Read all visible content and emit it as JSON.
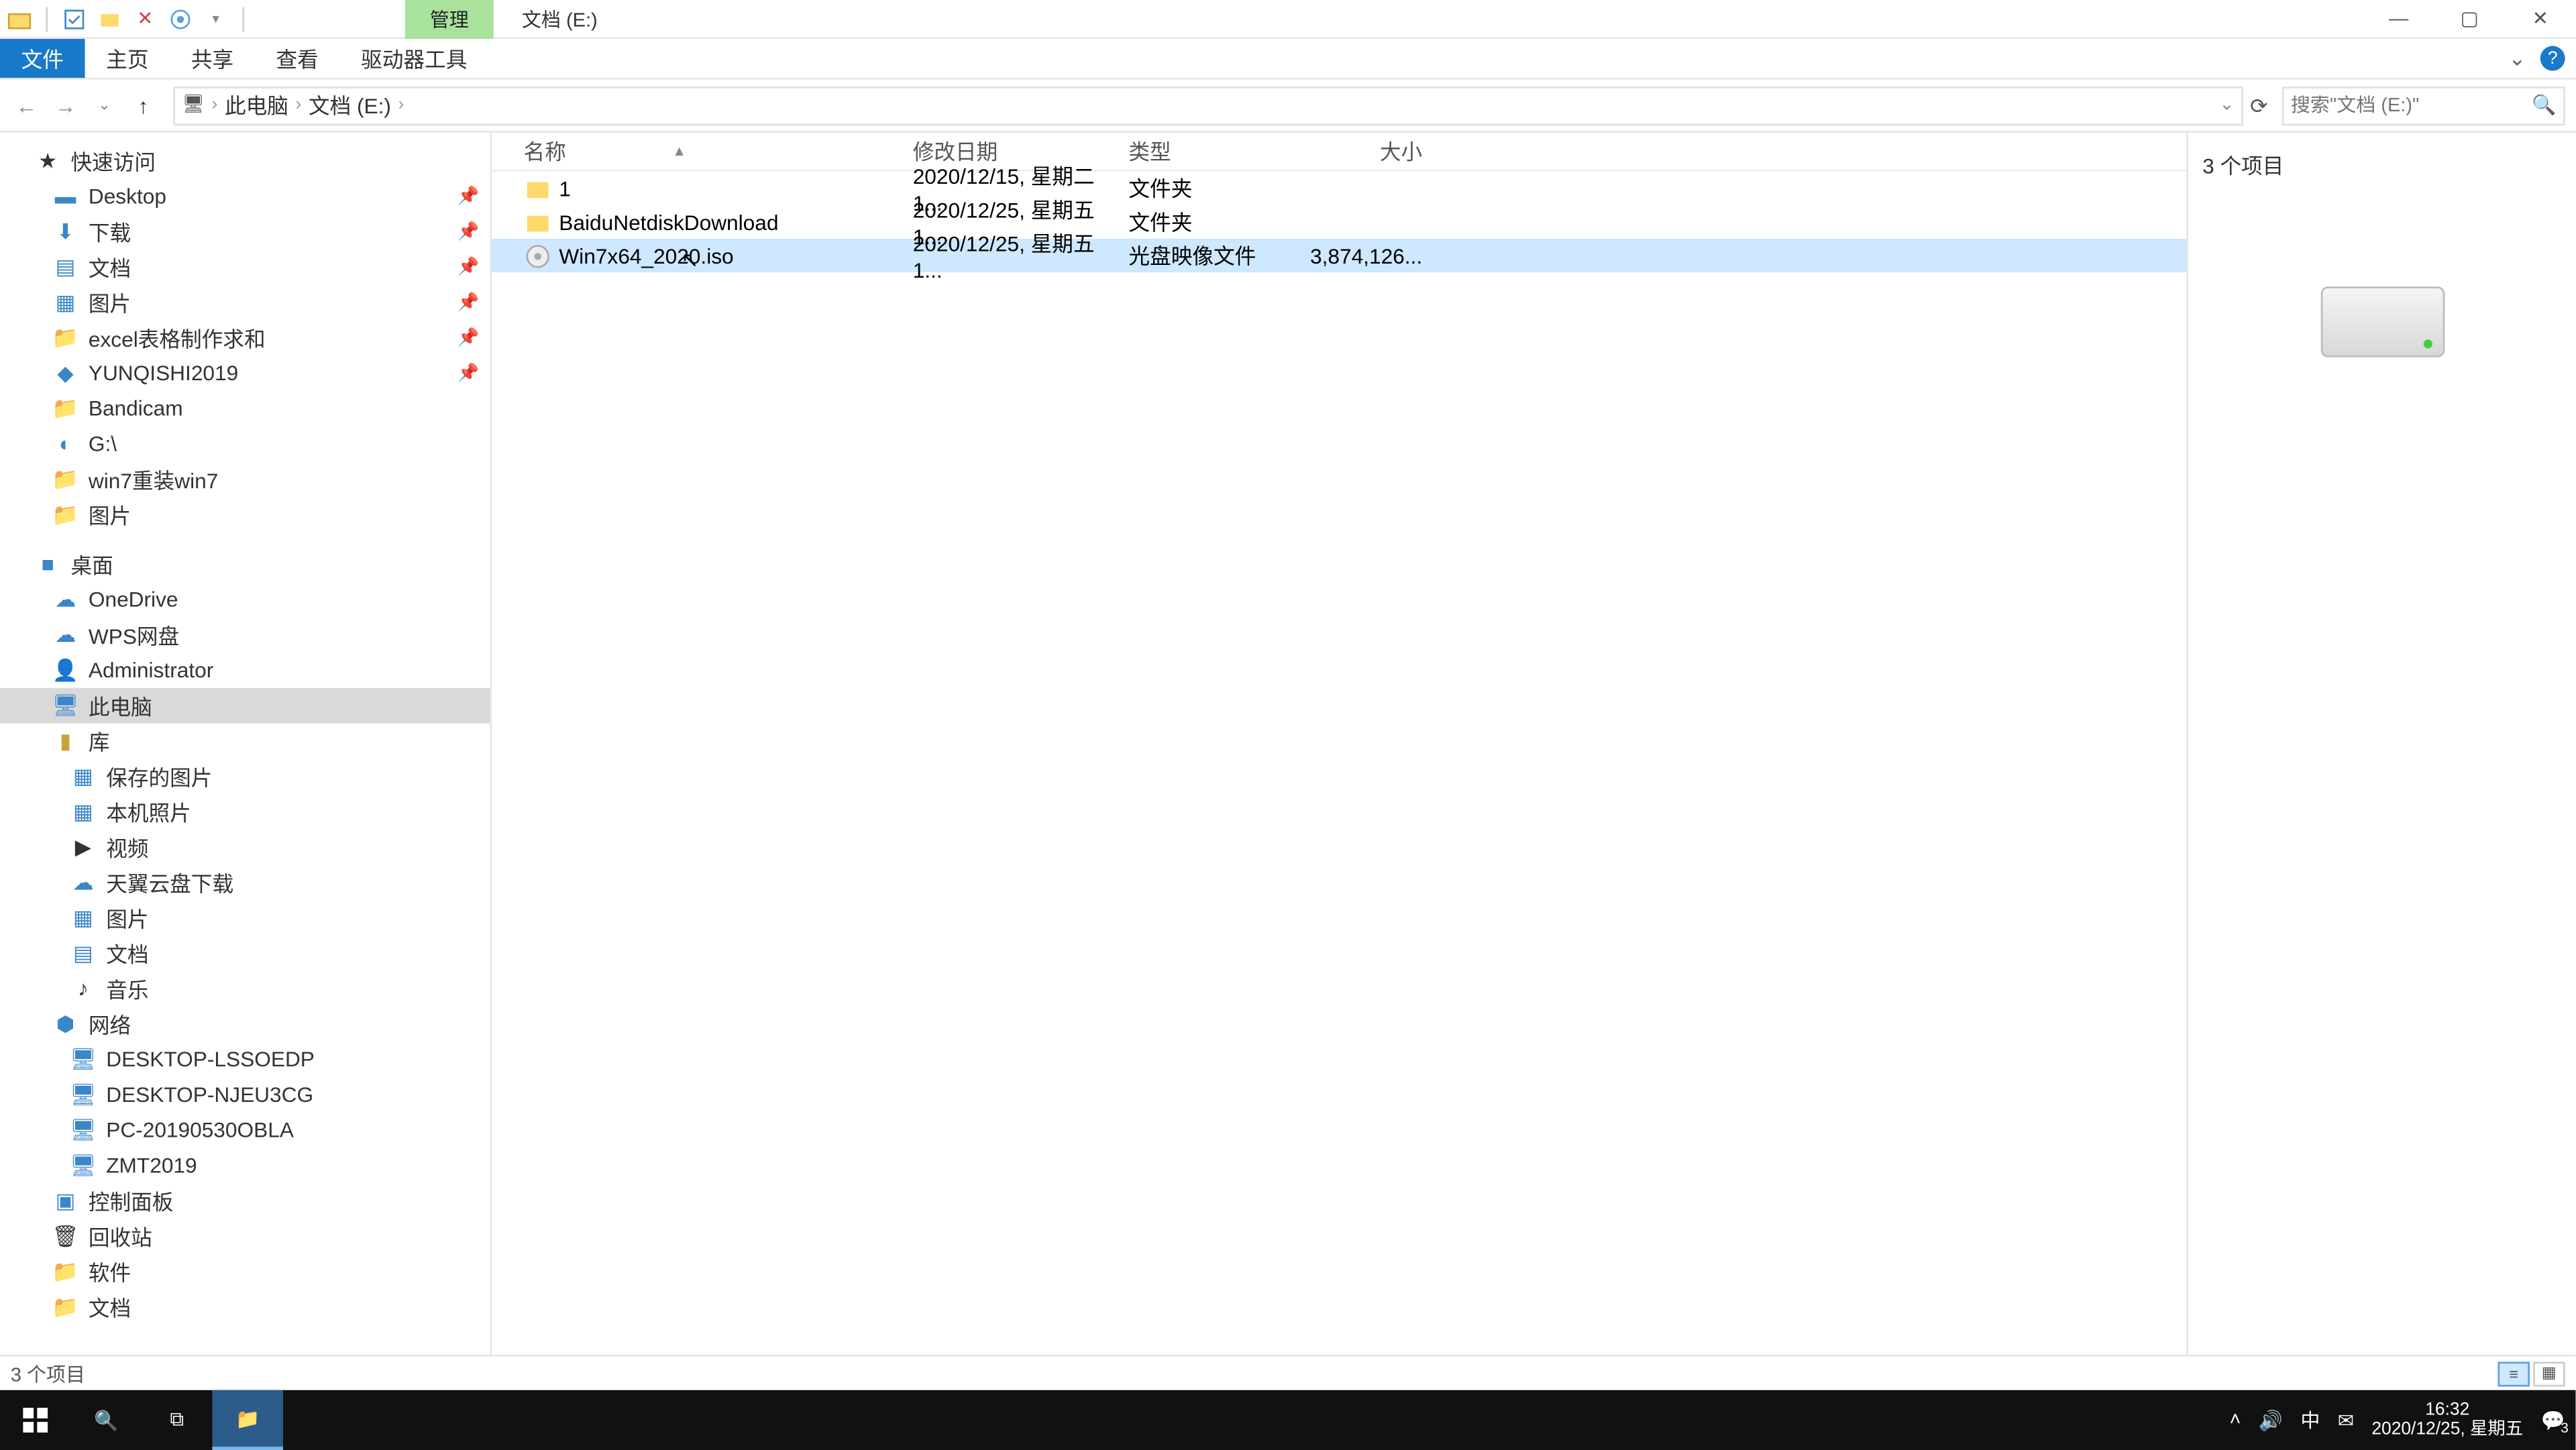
{
  "title": {
    "tools_tab": "管理",
    "location": "文档 (E:)"
  },
  "winbtns": {
    "min": "—",
    "max": "▢",
    "close": "✕"
  },
  "ribbon": {
    "file": "文件",
    "home": "主页",
    "share": "共享",
    "view": "查看",
    "drive_tools": "驱动器工具",
    "expand": "⌄",
    "help": "?"
  },
  "nav": {
    "back": "←",
    "fwd": "→",
    "recent": "⌄",
    "up": "↑"
  },
  "crumb": {
    "root_icon": "🖥",
    "pc": "此电脑",
    "drive": "文档 (E:)",
    "dropdown": "⌄",
    "refresh": "⟳"
  },
  "search": {
    "placeholder": "搜索\"文档 (E:)\"",
    "icon": "🔍"
  },
  "tree": {
    "quick": "快速访问",
    "desktop": "Desktop",
    "downloads": "下载",
    "docs": "文档",
    "pics": "图片",
    "excel": "excel表格制作求和",
    "yunqishi": "YUNQISHI2019",
    "bandicam": "Bandicam",
    "gdrive": "G:\\",
    "win7": "win7重装win7",
    "pics2": "图片",
    "desktop_root": "桌面",
    "onedrive": "OneDrive",
    "wps": "WPS网盘",
    "admin": "Administrator",
    "thispc": "此电脑",
    "lib": "库",
    "saved_pics": "保存的图片",
    "camera": "本机照片",
    "video": "视频",
    "tianyi": "天翼云盘下载",
    "pics3": "图片",
    "docs2": "文档",
    "music": "音乐",
    "network": "网络",
    "pc1": "DESKTOP-LSSOEDP",
    "pc2": "DESKTOP-NJEU3CG",
    "pc3": "PC-20190530OBLA",
    "pc4": "ZMT2019",
    "cpanel": "控制面板",
    "recycle": "回收站",
    "soft": "软件",
    "docs3": "文档"
  },
  "cols": {
    "name": "名称",
    "date": "修改日期",
    "type": "类型",
    "size": "大小"
  },
  "rows": [
    {
      "icon": "folder",
      "name": "1",
      "date": "2020/12/15, 星期二 1...",
      "type": "文件夹",
      "size": ""
    },
    {
      "icon": "folder",
      "name": "BaiduNetdiskDownload",
      "date": "2020/12/25, 星期五 1...",
      "type": "文件夹",
      "size": ""
    },
    {
      "icon": "iso",
      "name": "Win7x64_2020.iso",
      "date": "2020/12/25, 星期五 1...",
      "type": "光盘映像文件",
      "size": "3,874,126..."
    }
  ],
  "preview": {
    "count": "3 个项目"
  },
  "status": {
    "text": "3 个项目"
  },
  "taskbar": {
    "time": "16:32",
    "date": "2020/12/25, 星期五",
    "ime": "中",
    "count": "3"
  }
}
